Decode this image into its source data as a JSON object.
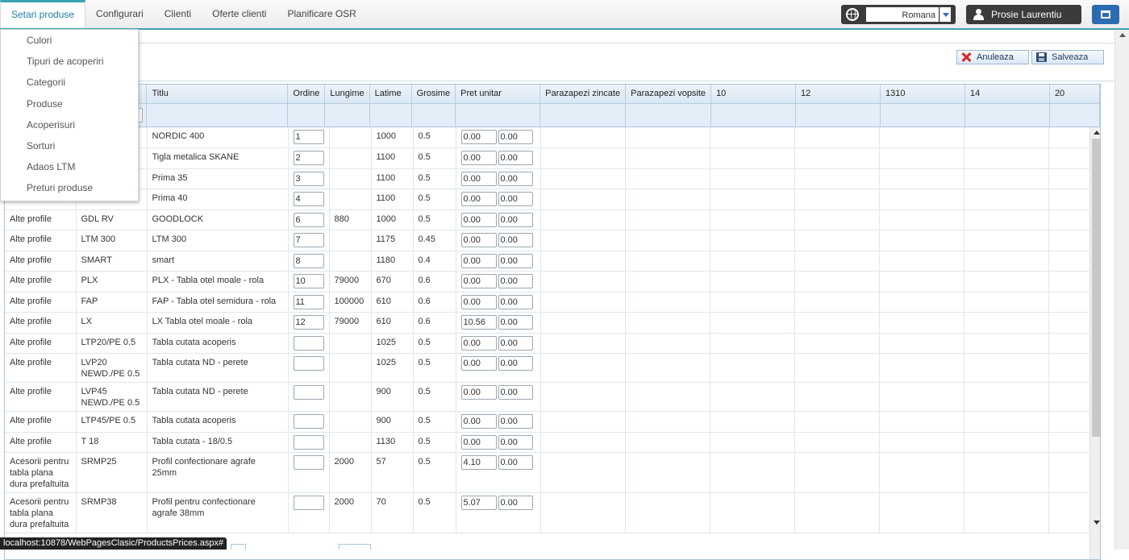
{
  "nav": {
    "tabs": [
      "Setari produse",
      "Configurari",
      "Clienti",
      "Oferte clienti",
      "Planificare OSR"
    ],
    "active_tab": "Setari produse"
  },
  "language": {
    "selected": "Romana"
  },
  "user": {
    "name": "Prosie Laurentiu"
  },
  "toolbar": {
    "cancel_label": "Anuleaza",
    "save_label": "Salveaza"
  },
  "menu": {
    "items": [
      "Culori",
      "Tipuri de acoperiri",
      "Categorii",
      "Produse",
      "Acoperisuri",
      "Sorturi",
      "Adaos LTM",
      "Preturi produse"
    ]
  },
  "grid": {
    "columns": [
      "",
      "",
      "Titlu",
      "Ordine",
      "Lungime",
      "Latime",
      "Grosime",
      "Pret unitar",
      "Parazapezi zincate",
      "Parazapezi vopsite",
      "10",
      "12",
      "1310",
      "14",
      "20"
    ],
    "rows": [
      {
        "cat": "",
        "code": "",
        "title": "NORDIC 400",
        "ordine": "1",
        "lungime": "",
        "latime": "1000",
        "grosime": "0.5",
        "pret1": "0.00",
        "pret2": "0.00"
      },
      {
        "cat": "",
        "code": "",
        "title": "Tigla metalica SKANE",
        "ordine": "2",
        "lungime": "",
        "latime": "1100",
        "grosime": "0.5",
        "pret1": "0.00",
        "pret2": "0.00"
      },
      {
        "cat": "",
        "code": "",
        "title": "Prima 35",
        "ordine": "3",
        "lungime": "",
        "latime": "1100",
        "grosime": "0.5",
        "pret1": "0.00",
        "pret2": "0.00"
      },
      {
        "cat": "",
        "code": "",
        "title": "Prima 40",
        "ordine": "4",
        "lungime": "",
        "latime": "1100",
        "grosime": "0.5",
        "pret1": "0.00",
        "pret2": "0.00"
      },
      {
        "cat": "Alte profile",
        "code": "GDL RV",
        "title": "GOODLOCK",
        "ordine": "6",
        "lungime": "880",
        "latime": "1000",
        "grosime": "0.5",
        "pret1": "0.00",
        "pret2": "0.00"
      },
      {
        "cat": "Alte profile",
        "code": "LTM 300",
        "title": "LTM 300",
        "ordine": "7",
        "lungime": "",
        "latime": "1175",
        "grosime": "0.45",
        "pret1": "0.00",
        "pret2": "0.00"
      },
      {
        "cat": "Alte profile",
        "code": "SMART",
        "title": "smart",
        "ordine": "8",
        "lungime": "",
        "latime": "1180",
        "grosime": "0.4",
        "pret1": "0.00",
        "pret2": "0.00"
      },
      {
        "cat": "Alte profile",
        "code": "PLX",
        "title": "PLX - Tabla otel moale - rola",
        "ordine": "10",
        "lungime": "79000",
        "latime": "670",
        "grosime": "0.6",
        "pret1": "0.00",
        "pret2": "0.00"
      },
      {
        "cat": "Alte profile",
        "code": "FAP",
        "title": "FAP - Tabla otel semidura - rola",
        "ordine": "11",
        "lungime": "100000",
        "latime": "610",
        "grosime": "0.6",
        "pret1": "0.00",
        "pret2": "0.00"
      },
      {
        "cat": "Alte profile",
        "code": "LX",
        "title": "LX Tabla otel moale - rola",
        "ordine": "12",
        "lungime": "79000",
        "latime": "610",
        "grosime": "0.6",
        "pret1": "10.56",
        "pret2": "0.00"
      },
      {
        "cat": "Alte profile",
        "code": "LTP20/PE 0.5",
        "title": "Tabla cutata acoperis",
        "ordine": "",
        "lungime": "",
        "latime": "1025",
        "grosime": "0.5",
        "pret1": "0.00",
        "pret2": "0.00"
      },
      {
        "cat": "Alte profile",
        "code": "LVP20 NEWD./PE 0.5",
        "title": "Tabla cutata ND - perete",
        "ordine": "",
        "lungime": "",
        "latime": "1025",
        "grosime": "0.5",
        "pret1": "0.00",
        "pret2": "0.00"
      },
      {
        "cat": "Alte profile",
        "code": "LVP45 NEWD./PE 0.5",
        "title": "Tabla cutata ND - perete",
        "ordine": "",
        "lungime": "",
        "latime": "900",
        "grosime": "0.5",
        "pret1": "0.00",
        "pret2": "0.00"
      },
      {
        "cat": "Alte profile",
        "code": "LTP45/PE 0.5",
        "title": "Tabla cutata acoperis",
        "ordine": "",
        "lungime": "",
        "latime": "900",
        "grosime": "0.5",
        "pret1": "0.00",
        "pret2": "0.00"
      },
      {
        "cat": "Alte profile",
        "code": "T 18",
        "title": "Tabla cutata - 18/0.5",
        "ordine": "",
        "lungime": "",
        "latime": "1130",
        "grosime": "0.5",
        "pret1": "0.00",
        "pret2": "0.00"
      },
      {
        "cat": "Acesorii pentru tabla plana dura prefaltuita",
        "code": "SRMP25",
        "title": "Profil confectionare agrafe 25mm",
        "ordine": "",
        "lungime": "2000",
        "latime": "57",
        "grosime": "0.5",
        "pret1": "4.10",
        "pret2": "0.00"
      },
      {
        "cat": "Acesorii pentru tabla plana dura prefaltuita",
        "code": "SRMP38",
        "title": "Profil pentru confectionare agrafe 38mm",
        "ordine": "",
        "lungime": "2000",
        "latime": "70",
        "grosime": "0.5",
        "pret1": "5.07",
        "pret2": "0.00"
      }
    ]
  },
  "status": {
    "url": "localhost:10878/WebPagesClasic/ProductsPrices.aspx#"
  },
  "icons": {
    "language": "globe-icon",
    "user": "user-icon",
    "window": "window-icon",
    "cancel": "cancel-x-icon",
    "save": "save-disk-icon"
  },
  "colors": {
    "accent": "#3aa2b4",
    "active_tab_text": "#1e7fa5",
    "dark_box": "#3b3b3b",
    "blue_button": "#2b6cb0",
    "cancel_red": "#dd2222"
  }
}
